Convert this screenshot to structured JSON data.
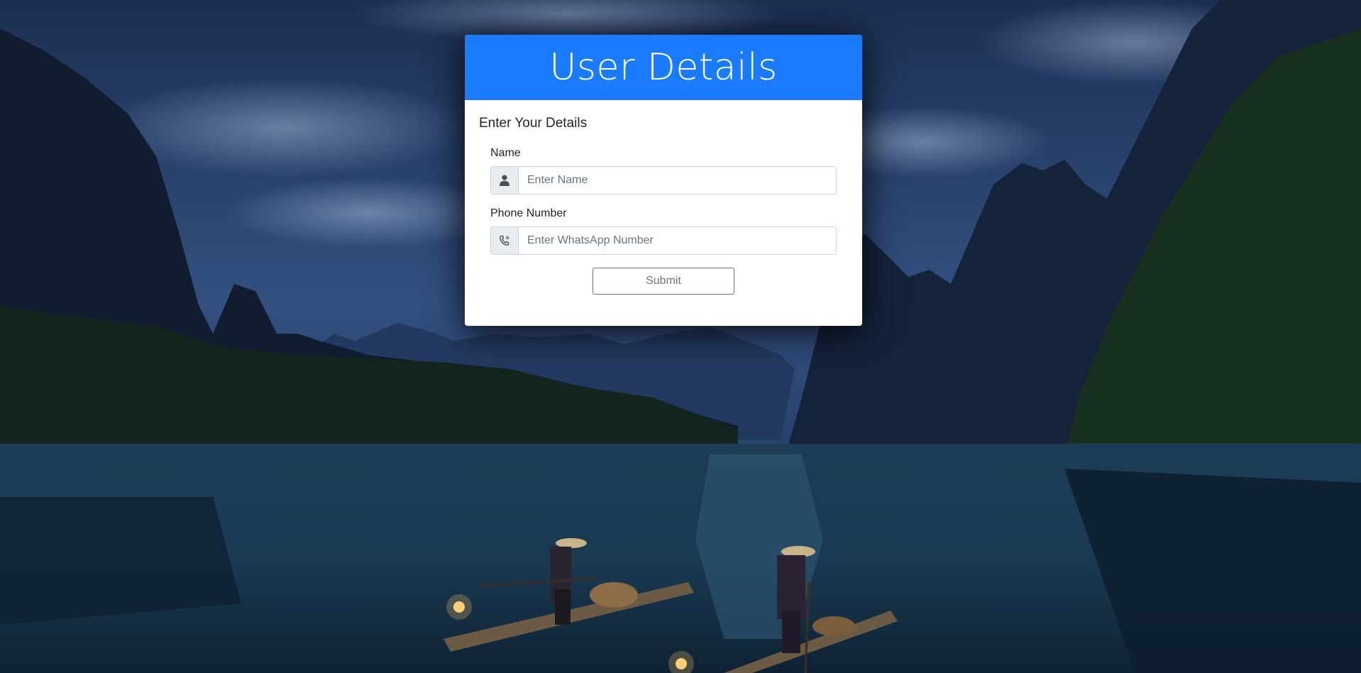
{
  "header": {
    "title": "User Details"
  },
  "form": {
    "subtitle": "Enter Your Details",
    "name": {
      "label": "Name",
      "placeholder": "Enter Name",
      "value": "",
      "icon": "user-icon"
    },
    "phone": {
      "label": "Phone Number",
      "placeholder": "Enter WhatsApp Number",
      "value": "",
      "icon": "phone-icon"
    },
    "submit_label": "Submit"
  },
  "colors": {
    "header_bg": "#1a7bff",
    "card_bg": "#ffffff",
    "input_addon_bg": "#e9ecef"
  }
}
